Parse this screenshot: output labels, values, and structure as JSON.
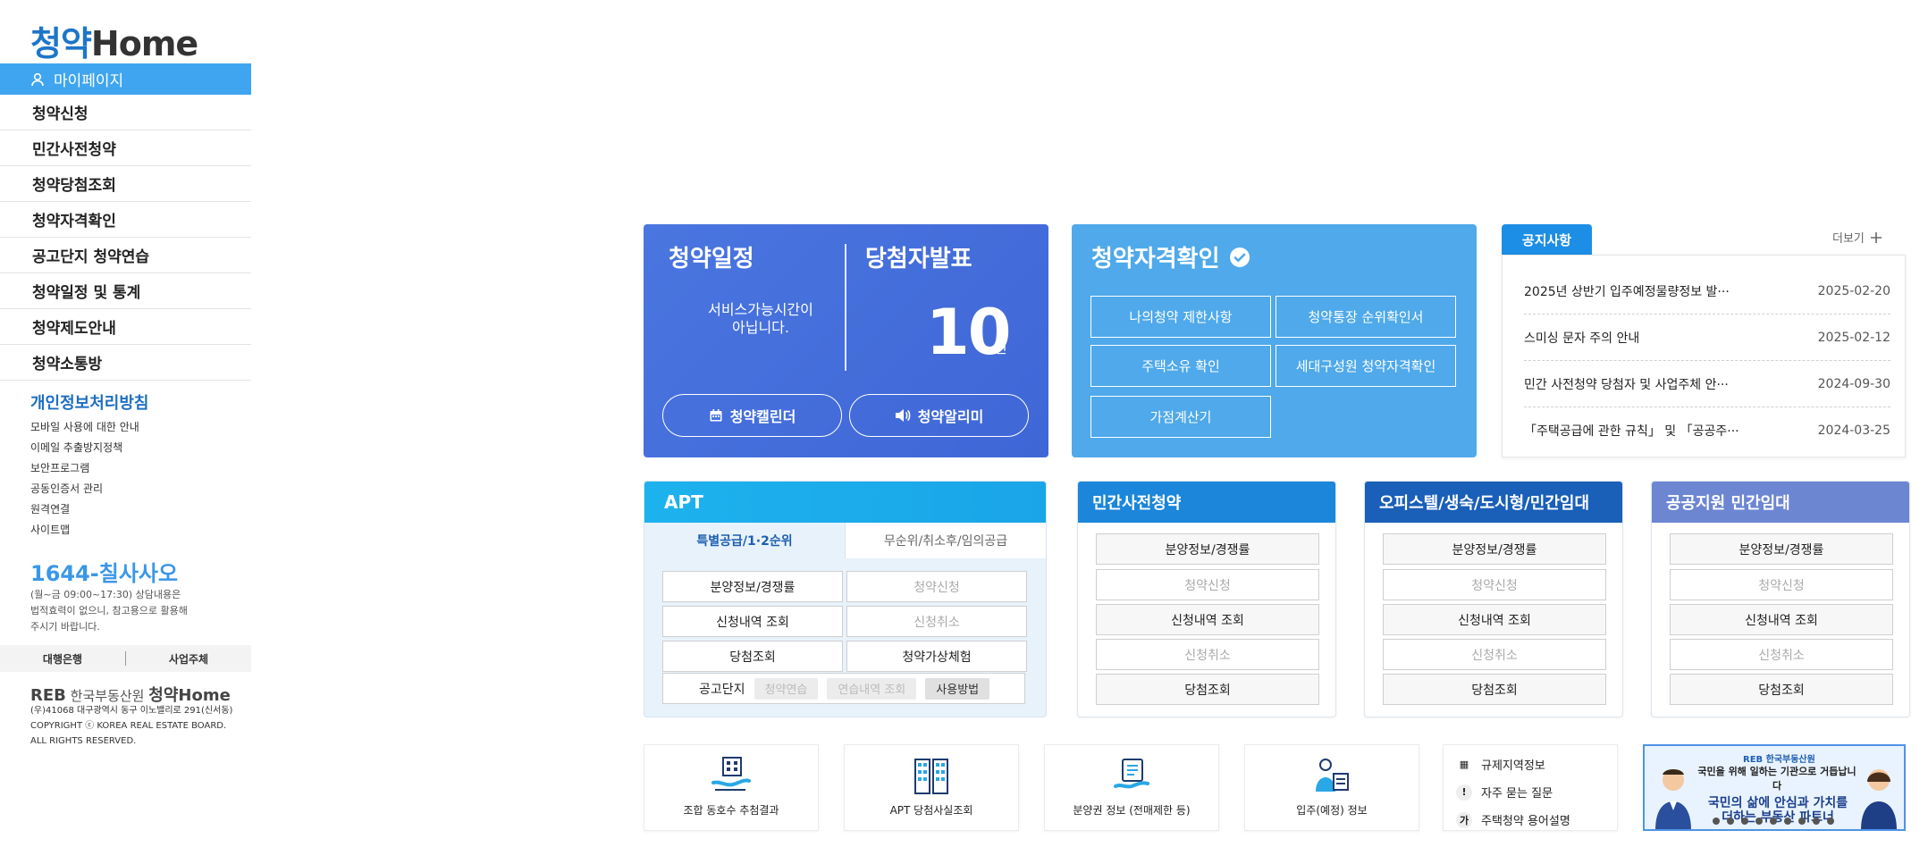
{
  "sidebar": {
    "logo_prefix": "청약",
    "logo_suffix": "Home",
    "mypage": "마이페이지",
    "menu": [
      "청약신청",
      "민간사전청약",
      "청약당첨조회",
      "청약자격확인",
      "공고단지 청약연습",
      "청약일정 및 통계",
      "청약제도안내",
      "청약소통방"
    ],
    "privacy": "개인정보처리방침",
    "links": [
      "모바일 사용에 대한 안내",
      "이메일 추출방지정책",
      "보안프로그램",
      "공동인증서 관리",
      "원격연결",
      "사이트맵"
    ],
    "phone": "1644-칠사사오",
    "phone_note": [
      "(월~금 09:00~17:30) 상담내용은",
      "법적효력이 없으니, 참고용으로 활용해",
      "주시기 바랍니다."
    ],
    "bank": "대행은행",
    "business": "사업주체",
    "reb_logo": "REB",
    "reb_text": "한국부동산원",
    "reb_home": "청약Home",
    "address": [
      "(우)41068 대구광역시 동구 이노밸리로 291(신서동)",
      "COPYRIGHT ⓒ KOREA REAL ESTATE BOARD.",
      "ALL RIGHTS RESERVED."
    ]
  },
  "schedule": {
    "title": "청약일정",
    "message_l1": "서비스가능시간이",
    "message_l2": "아닙니다.",
    "winner_title": "당첨자발표",
    "winner_count": "10",
    "winner_unit": "건",
    "calendar_btn": "청약캘린더",
    "alarm_btn": "청약알리미"
  },
  "qualification": {
    "title": "청약자격확인",
    "buttons": [
      "나의청약 제한사항",
      "청약통장 순위확인서",
      "주택소유 확인",
      "세대구성원 청약자격확인",
      "가점계산기"
    ]
  },
  "notice": {
    "tab": "공지사항",
    "more": "더보기",
    "items": [
      {
        "title": "2025년 상반기 입주예정물량정보 발···",
        "date": "2025-02-20"
      },
      {
        "title": "스미싱 문자 주의 안내",
        "date": "2025-02-12"
      },
      {
        "title": "민간 사전청약 당첨자 및 사업주체 안···",
        "date": "2024-09-30"
      },
      {
        "title": "「주택공급에 관한 규칙」 및 「공공주···",
        "date": "2024-03-25"
      }
    ]
  },
  "apt": {
    "title": "APT",
    "tab_active": "특별공급/1·2순위",
    "tab_inactive": "무순위/취소후/임의공급",
    "buttons": [
      "분양정보/경쟁률",
      "청약신청",
      "신청내역 조회",
      "신청취소",
      "당첨조회",
      "청약가상체험"
    ],
    "gongo_label": "공고단지",
    "chips": [
      "청약연습",
      "연습내역 조회",
      "사용방법"
    ]
  },
  "private_pre": {
    "title": "민간사전청약",
    "buttons": [
      "분양정보/경쟁률",
      "청약신청",
      "신청내역 조회",
      "신청취소",
      "당첨조회"
    ]
  },
  "officetel": {
    "title": "오피스텔/생숙/도시형/민간임대",
    "buttons": [
      "분양정보/경쟁률",
      "청약신청",
      "신청내역 조회",
      "신청취소",
      "당첨조회"
    ]
  },
  "public_rental": {
    "title": "공공지원 민간임대",
    "buttons": [
      "분양정보/경쟁률",
      "청약신청",
      "신청내역 조회",
      "신청취소",
      "당첨조회"
    ]
  },
  "quick": {
    "items": [
      "조합 동호수 추첨결과",
      "APT 당첨사실조회",
      "분양권 정보 (전매제한 등)",
      "입주(예정) 정보"
    ],
    "list": [
      "규제지역정보",
      "자주 묻는 질문",
      "주택청약 용어설명"
    ]
  },
  "banner": {
    "brand": "REB 한국부동산원",
    "line1": "국민을 위해 일하는 기관으로 거듭납니다",
    "line2": "국민의 삶에 안심과 가치를",
    "line3": "더하는 부동산 파트너"
  },
  "colors": {
    "primary": "#3fa5f0",
    "schedule_bg": "#4a76e0",
    "qual_bg": "#4fa9ea",
    "apt_head": "#1db2ee",
    "private_head": "#1b86da",
    "officetel_head": "#1a5fb8",
    "rental_head": "#6c86d2"
  }
}
